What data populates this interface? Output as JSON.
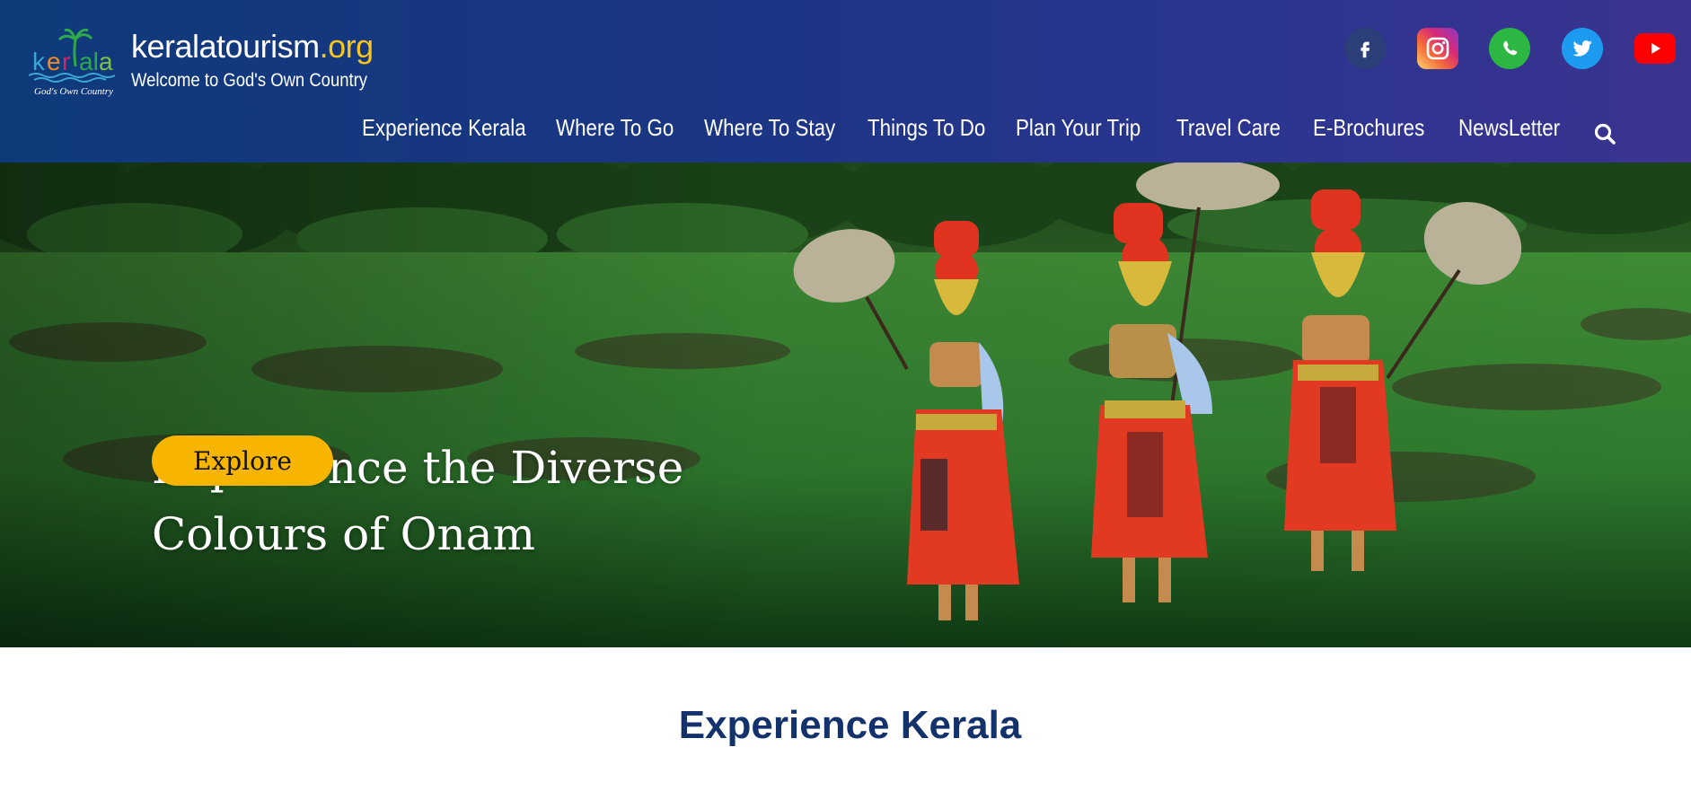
{
  "header": {
    "logo_tagline": "God's Own Country",
    "site_name_main": "keralatourism",
    "site_name_tld": ".org",
    "site_subtitle": "Welcome to God's Own Country",
    "social": [
      {
        "name": "facebook",
        "icon": "facebook-icon",
        "color": "#2c3f78"
      },
      {
        "name": "instagram",
        "icon": "instagram-icon",
        "color": "#d62978"
      },
      {
        "name": "whatsapp",
        "icon": "whatsapp-icon",
        "color": "#2bb742"
      },
      {
        "name": "twitter",
        "icon": "twitter-icon",
        "color": "#1d9bf0"
      },
      {
        "name": "youtube",
        "icon": "youtube-icon",
        "color": "#ff0000"
      }
    ]
  },
  "nav": {
    "items": [
      "Experience Kerala",
      "Where To Go",
      "Where To Stay",
      "Things To Do",
      "Plan Your Trip",
      "Travel Care",
      "E-Brochures",
      "NewsLetter"
    ],
    "search_icon": "search-icon"
  },
  "hero": {
    "title_line1": "Experience the Diverse",
    "title_line2": "Colours of Onam",
    "cta_label": "Explore",
    "cta_color": "#f7b500"
  },
  "section": {
    "title": "Experience Kerala",
    "title_color": "#13326b"
  },
  "colors": {
    "header_gradient_start": "#0e3a7a",
    "header_gradient_end": "#3a348f",
    "brand_yellow": "#f7c51b"
  }
}
